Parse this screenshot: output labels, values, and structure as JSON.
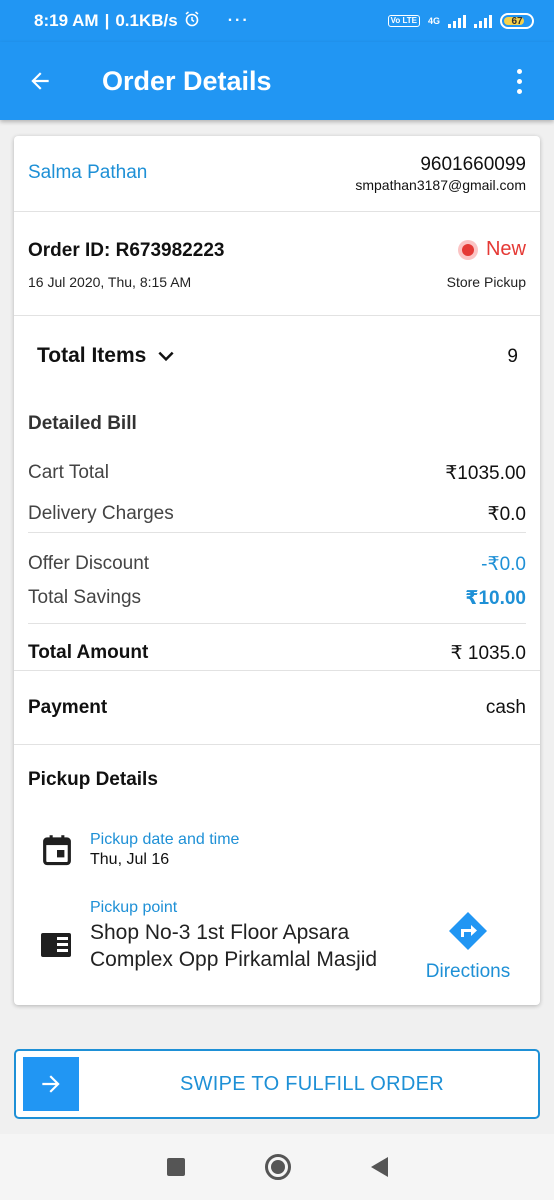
{
  "status_bar": {
    "time": "8:19 AM",
    "speed": "0.1KB/s",
    "dots": "···",
    "volte": "Vo LTE",
    "network": "4G",
    "battery": "67"
  },
  "app_bar": {
    "title": "Order Details"
  },
  "customer": {
    "name": "Salma Pathan",
    "phone": "9601660099",
    "email": "smpathan3187@gmail.com"
  },
  "order": {
    "id_label": "Order ID: R673982223",
    "date": "16 Jul 2020, Thu, 8:15 AM",
    "status": "New",
    "type": "Store Pickup"
  },
  "items": {
    "label": "Total Items",
    "count": "9"
  },
  "bill": {
    "heading": "Detailed Bill",
    "cart_total_label": "Cart Total",
    "cart_total_value": "₹1035.00",
    "delivery_label": "Delivery Charges",
    "delivery_value": "₹0.0",
    "offer_label": "Offer Discount",
    "offer_value": "-₹0.0",
    "savings_label": "Total Savings",
    "savings_value": "₹10.00",
    "total_label": "Total Amount",
    "total_value": "₹ 1035.0"
  },
  "payment": {
    "label": "Payment",
    "value": "cash"
  },
  "pickup": {
    "heading": "Pickup Details",
    "datetime_label": "Pickup date and time",
    "datetime_value": "Thu, Jul 16",
    "point_label": "Pickup point",
    "address_line1": "Shop No-3 1st Floor Apsara",
    "address_line2": "Complex Opp Pirkamlal Masjid",
    "directions_label": "Directions"
  },
  "swipe": {
    "label": "SWIPE TO FULFILL ORDER"
  },
  "colors": {
    "primary": "#2196f3",
    "accent_text": "#1e90d6",
    "status_new": "#e53935"
  },
  "icons": {
    "back": "arrow-left-icon",
    "more": "more-vertical-icon",
    "expand": "chevron-down-icon",
    "calendar": "calendar-icon",
    "store": "store-icon",
    "directions": "directions-icon",
    "swipe": "arrow-right-icon"
  }
}
